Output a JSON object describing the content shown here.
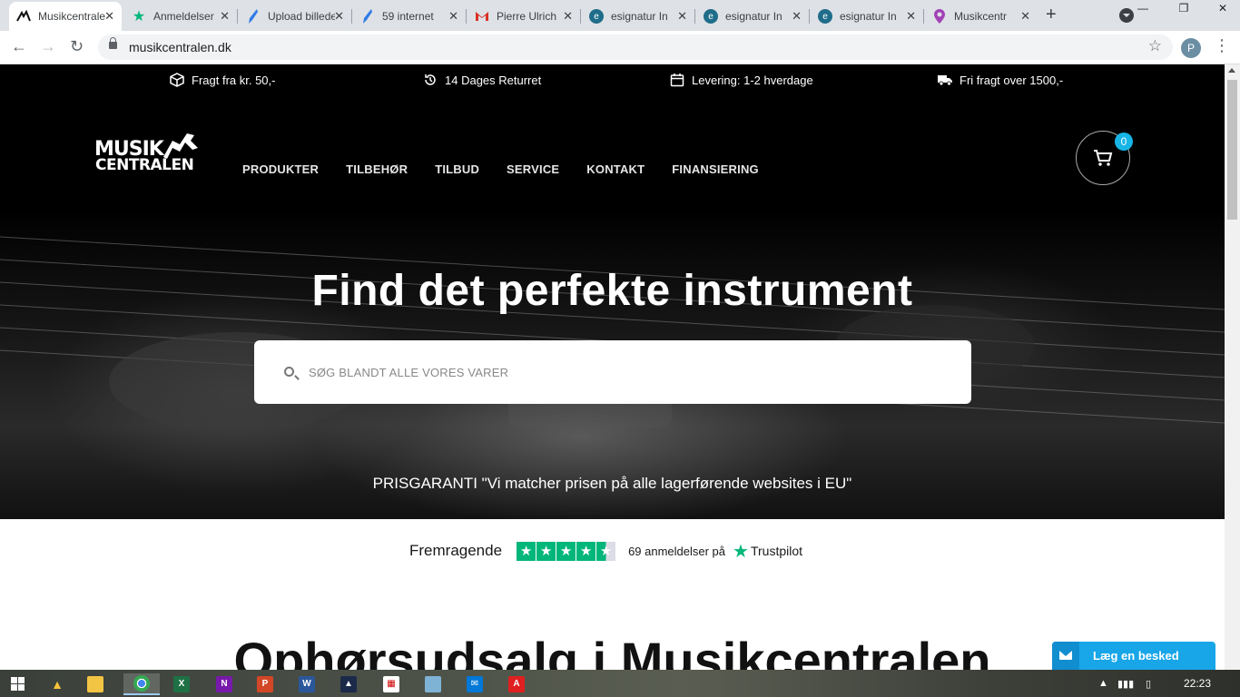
{
  "browser": {
    "tabs": [
      {
        "title": "Musikcentralen",
        "favicon": "musikcentralen-logo",
        "active": true
      },
      {
        "title": "Anmeldelser",
        "favicon": "trustpilot-star"
      },
      {
        "title": "Upload billede",
        "favicon": "feather-icon"
      },
      {
        "title": "59 internet",
        "favicon": "feather-icon"
      },
      {
        "title": "Pierre Ulrich",
        "favicon": "gmail-icon"
      },
      {
        "title": "esignatur In",
        "favicon": "esignatur-icon"
      },
      {
        "title": "esignatur In",
        "favicon": "esignatur-icon"
      },
      {
        "title": "esignatur In",
        "favicon": "esignatur-icon"
      },
      {
        "title": "Musikcentr",
        "favicon": "map-pin-icon"
      }
    ],
    "url": "musikcentralen.dk",
    "profile_initial": "P"
  },
  "topbar": {
    "usps": [
      {
        "icon": "box-icon",
        "text": "Fragt fra kr. 50,-"
      },
      {
        "icon": "history-icon",
        "text": "14 Dages Returret"
      },
      {
        "icon": "calendar-icon",
        "text": "Levering: 1-2 hverdage"
      },
      {
        "icon": "truck-icon",
        "text": "Fri fragt over 1500,-"
      }
    ]
  },
  "header": {
    "logo_line1": "MUSIK",
    "logo_line2": "CENTRALEN",
    "nav": [
      "PRODUKTER",
      "TILBEHØR",
      "TILBUD",
      "SERVICE",
      "KONTAKT",
      "FINANSIERING"
    ],
    "cart_count": "0"
  },
  "hero": {
    "headline": "Find det perfekte instrument",
    "search_placeholder": "SØG BLANDT ALLE VORES VARER",
    "price_guarantee": "PRISGARANTI \"Vi matcher prisen på alle lagerførende websites i EU\""
  },
  "trustpilot": {
    "rating_label": "Fremragende",
    "stars": 4.5,
    "reviews_text": "69 anmeldelser på",
    "brand": "Trustpilot"
  },
  "content": {
    "title": "Ophørsudsalg i Musikcentralen"
  },
  "chat": {
    "label": "Læg en besked"
  },
  "taskbar": {
    "apps": [
      "explorer-icon",
      "people-icon",
      "file-explorer-icon",
      "chrome-icon",
      "excel-icon",
      "onenote-icon",
      "powerpoint-icon",
      "word-icon",
      "app-icon",
      "calendar-app-icon",
      "photos-icon",
      "mail-icon",
      "acrobat-icon"
    ],
    "time": "22:23"
  },
  "colors": {
    "accent": "#17b5e6",
    "trustpilot_green": "#00b67a",
    "chat_blue": "#18a6e8"
  }
}
